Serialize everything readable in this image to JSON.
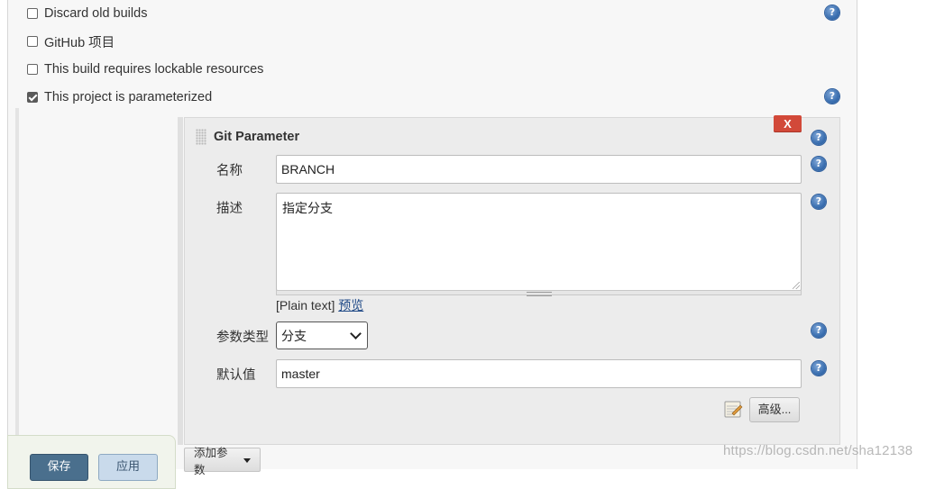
{
  "options": [
    {
      "label": "Discard old builds",
      "checked": false,
      "has_help": true
    },
    {
      "label": "GitHub 项目",
      "checked": false,
      "has_help": false
    },
    {
      "label": "This build requires lockable resources",
      "checked": false,
      "has_help": false
    },
    {
      "label": "This project is parameterized",
      "checked": true,
      "has_help": true
    }
  ],
  "help_glyph": "?",
  "parameter": {
    "title": "Git Parameter",
    "delete_label": "X",
    "name": {
      "label": "名称",
      "value": "BRANCH"
    },
    "description": {
      "label": "描述",
      "value": "指定分支",
      "format": "[Plain text]",
      "preview_label": "预览"
    },
    "param_type": {
      "label": "参数类型",
      "selected": "分支"
    },
    "default_value": {
      "label": "默认值",
      "value": "master"
    },
    "advanced_label": "高级..."
  },
  "add_parameter_label": "添加参数",
  "buttons": {
    "save": "保存",
    "apply": "应用"
  },
  "watermark": "https://blog.csdn.net/sha12138",
  "colors": {
    "delete": "#d24939",
    "save": "#4a6f8d",
    "apply": "#c9daeb",
    "help": "#3a6fb0",
    "link": "#204a87"
  }
}
